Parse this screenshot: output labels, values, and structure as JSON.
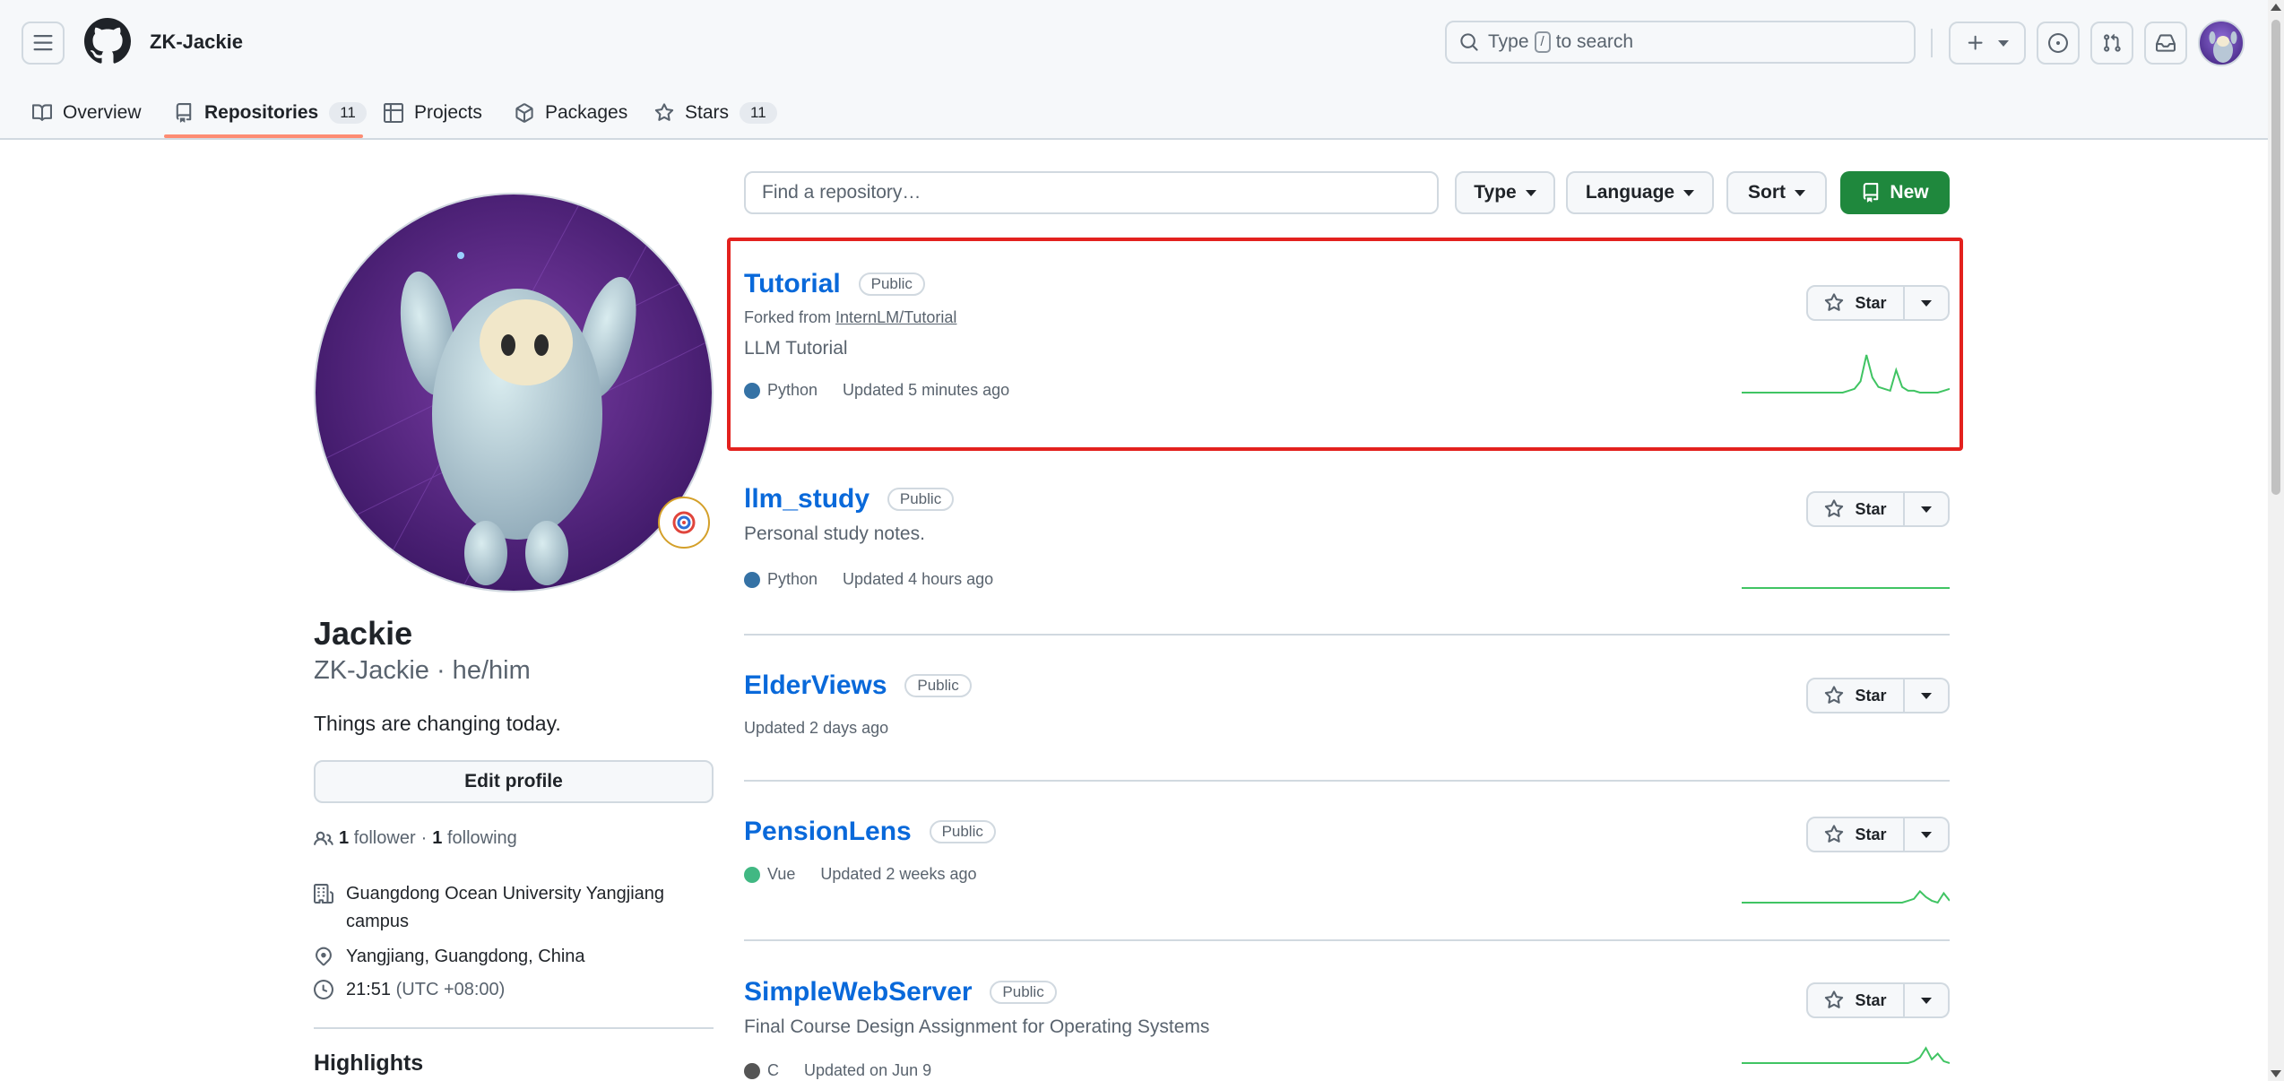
{
  "header": {
    "owner": "ZK-Jackie",
    "search": {
      "prefix": "Type",
      "key": "/",
      "suffix": "to search"
    }
  },
  "tabs": [
    {
      "label": "Overview",
      "count": ""
    },
    {
      "label": "Repositories",
      "count": "11"
    },
    {
      "label": "Projects",
      "count": ""
    },
    {
      "label": "Packages",
      "count": ""
    },
    {
      "label": "Stars",
      "count": "11"
    }
  ],
  "profile": {
    "name": "Jackie",
    "login": "ZK-Jackie · he/him",
    "bio": "Things are changing today.",
    "edit_label": "Edit profile",
    "followers_count": "1",
    "followers_label": "follower",
    "following_count": "1",
    "following_label": "following",
    "dot": "·",
    "organization": "Guangdong Ocean University Yangjiang campus",
    "location": "Yangjiang, Guangdong, China",
    "local_time": "21:51",
    "timezone": "(UTC +08:00)",
    "highlights_title": "Highlights"
  },
  "toolbar": {
    "find_placeholder": "Find a repository…",
    "type_label": "Type",
    "language_label": "Language",
    "sort_label": "Sort",
    "new_label": "New"
  },
  "repos": [
    {
      "name": "Tutorial",
      "visibility": "Public",
      "forked_prefix": "Forked from",
      "forked_from": "InternLM/Tutorial",
      "description": "LLM Tutorial",
      "language": "Python",
      "language_color": "#3572A5",
      "updated": "Updated 5 minutes ago",
      "star_label": "Star",
      "activity": [
        0,
        0,
        0,
        0,
        0,
        0,
        0,
        0,
        0,
        0,
        0,
        0,
        0,
        0,
        0,
        0,
        0,
        0,
        1,
        2,
        6,
        20,
        8,
        3,
        2,
        1,
        12,
        3,
        1,
        1,
        0,
        0,
        0,
        0,
        1,
        2
      ]
    },
    {
      "name": "llm_study",
      "visibility": "Public",
      "description": "Personal study notes.",
      "language": "Python",
      "language_color": "#3572A5",
      "updated": "Updated 4 hours ago",
      "star_label": "Star",
      "activity": [
        0,
        0,
        0,
        0,
        0,
        0,
        0,
        0,
        0,
        0,
        0,
        0,
        0,
        0,
        0,
        0,
        0,
        0,
        0,
        0,
        0,
        0,
        0,
        0,
        0,
        0,
        0,
        0,
        0,
        0,
        0,
        0,
        0,
        0,
        0,
        0
      ]
    },
    {
      "name": "ElderViews",
      "visibility": "Public",
      "updated": "Updated 2 days ago",
      "star_label": "Star"
    },
    {
      "name": "PensionLens",
      "visibility": "Public",
      "language": "Vue",
      "language_color": "#41b883",
      "updated": "Updated 2 weeks ago",
      "star_label": "Star",
      "activity": [
        0,
        0,
        0,
        0,
        0,
        0,
        0,
        0,
        0,
        0,
        0,
        0,
        0,
        0,
        0,
        0,
        0,
        0,
        0,
        0,
        0,
        0,
        0,
        0,
        0,
        0,
        0,
        0,
        1,
        2,
        6,
        3,
        1,
        0,
        5,
        1
      ]
    },
    {
      "name": "SimpleWebServer",
      "visibility": "Public",
      "description": "Final Course Design Assignment for Operating Systems",
      "language": "C",
      "language_color": "#555555",
      "updated": "Updated on Jun 9",
      "star_label": "Star",
      "activity": [
        0,
        0,
        0,
        0,
        0,
        0,
        0,
        0,
        0,
        0,
        0,
        0,
        0,
        0,
        0,
        0,
        0,
        0,
        0,
        0,
        0,
        0,
        0,
        0,
        0,
        0,
        0,
        0,
        0,
        1,
        3,
        8,
        2,
        5,
        1,
        0
      ]
    }
  ],
  "colors": {
    "link": "#0969da",
    "primary_button": "#1f883d",
    "sparkline": "#40c463",
    "highlight_box": "#e3211e",
    "tab_underline": "#fd8c73"
  }
}
